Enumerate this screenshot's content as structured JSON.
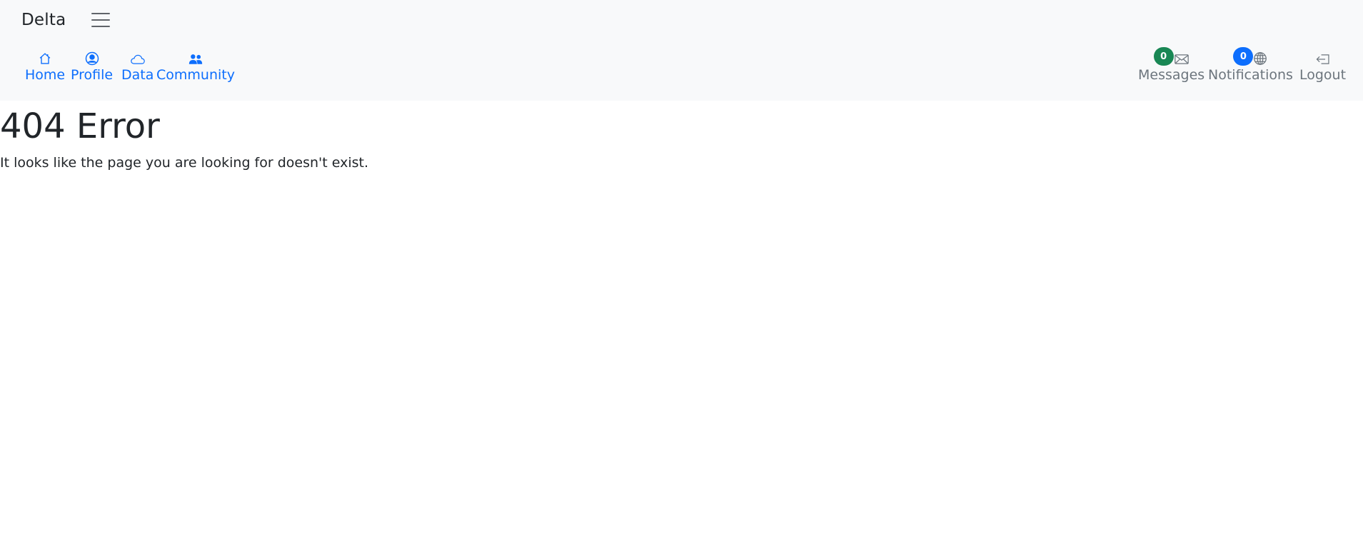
{
  "navbar": {
    "brand": "Delta",
    "left_items": [
      {
        "label": "Home",
        "icon": "house-icon"
      },
      {
        "label": "Profile",
        "icon": "person-circle-icon"
      },
      {
        "label": "Data",
        "icon": "cloud-icon"
      },
      {
        "label": "Community",
        "icon": "people-icon"
      }
    ],
    "right_items": [
      {
        "label": "Messages",
        "icon": "envelope-icon",
        "badge": "0",
        "badge_color": "#198754"
      },
      {
        "label": "Notifications",
        "icon": "globe-icon",
        "badge": "0",
        "badge_color": "#0d6efd"
      },
      {
        "label": "Logout",
        "icon": "box-arrow-left-icon"
      }
    ]
  },
  "main": {
    "title": "404 Error",
    "message": "It looks like the page you are looking for doesn't exist."
  },
  "colors": {
    "link": "#0d6efd",
    "muted": "#6c757d",
    "navbar_bg": "#f8f9fa"
  }
}
